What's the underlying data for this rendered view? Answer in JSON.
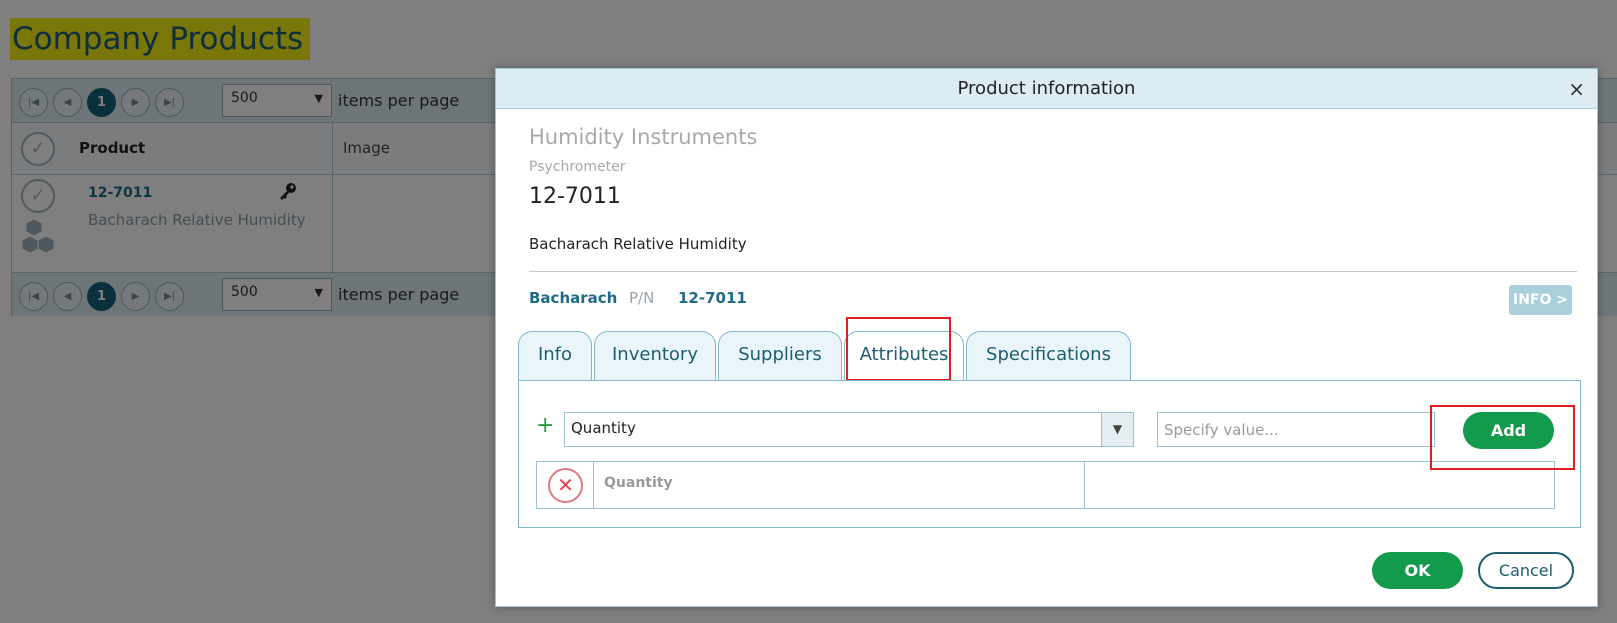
{
  "page": {
    "title": "Company Products"
  },
  "grid": {
    "pager_top": {
      "current_page": "1",
      "page_size": "500",
      "items_label": "items per page"
    },
    "pager_bottom": {
      "current_page": "1",
      "page_size": "500",
      "items_label": "items per page"
    },
    "columns": [
      "Product",
      "Image"
    ],
    "rows": [
      {
        "code": "12-7011",
        "description": "Bacharach Relative Humidity"
      }
    ]
  },
  "modal": {
    "title": "Product information",
    "category": "Humidity Instruments",
    "subcategory": "Psychrometer",
    "code": "12-7011",
    "description": "Bacharach Relative Humidity",
    "brand": "Bacharach",
    "pn_label": "P/N",
    "pn": "12-7011",
    "info_button": "INFO >",
    "tabs": [
      "Info",
      "Inventory",
      "Suppliers",
      "Attributes",
      "Specifications"
    ],
    "active_tab": "Attributes",
    "attributes": {
      "select_value": "Quantity",
      "value_placeholder": "Specify value...",
      "add_label": "Add",
      "rows": [
        {
          "name": "Quantity",
          "value": ""
        }
      ]
    },
    "ok_label": "OK",
    "cancel_label": "Cancel"
  },
  "colors": {
    "accent": "#1f5c72",
    "primary_button": "#149a4c",
    "highlight": "#f2ef14",
    "annotation_frame": "#e31b23"
  }
}
